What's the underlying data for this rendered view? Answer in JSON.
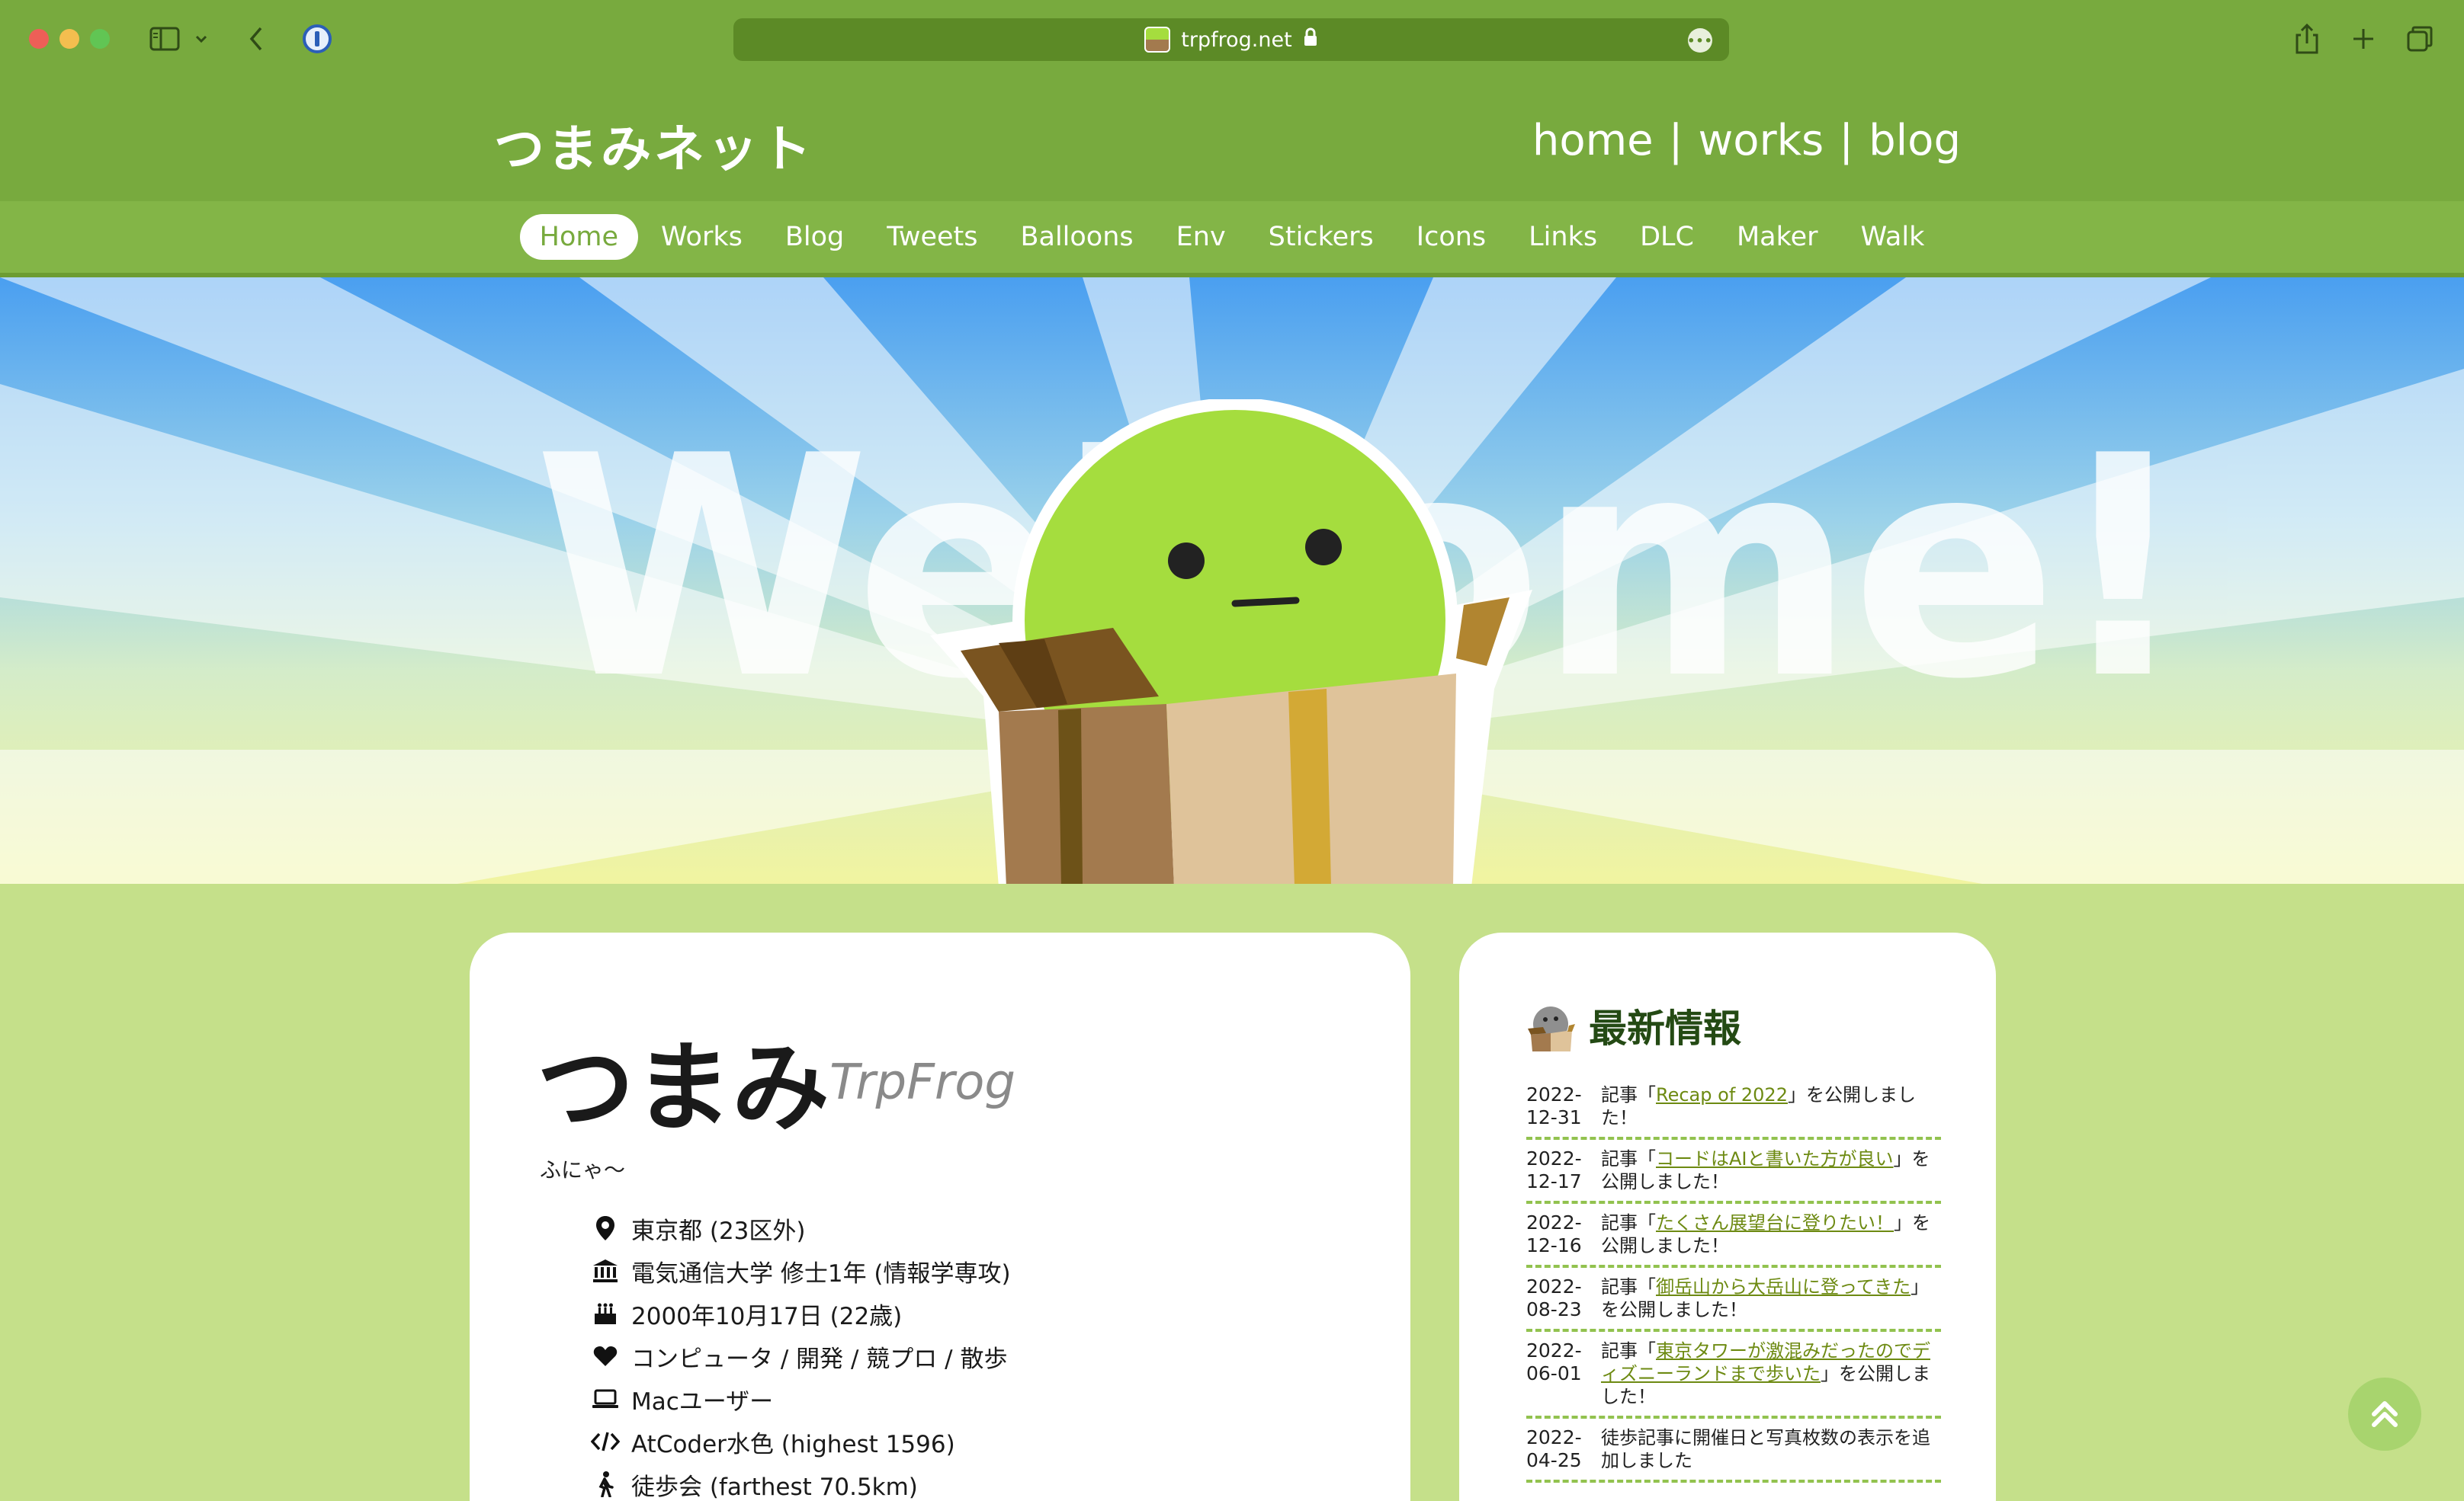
{
  "browser": {
    "url": "trpfrog.net"
  },
  "site": {
    "logo": "つまみネット",
    "top_links": [
      "home",
      "|",
      "works",
      "|",
      "blog"
    ],
    "nav": [
      "Home",
      "Works",
      "Blog",
      "Tweets",
      "Balloons",
      "Env",
      "Stickers",
      "Icons",
      "Links",
      "DLC",
      "Maker",
      "Walk"
    ],
    "active_nav": "Home"
  },
  "hero": {
    "welcome_text": "Welcome!"
  },
  "profile": {
    "name": "つまみ",
    "handle": "TrpFrog",
    "tagline": "ふにゃ〜",
    "info": [
      {
        "icon": "location-pin-icon",
        "text": "東京都 (23区外)"
      },
      {
        "icon": "university-icon",
        "text": "電気通信大学 修士1年 (情報学専攻)"
      },
      {
        "icon": "birthday-cake-icon",
        "text": "2000年10月17日 (22歳)"
      },
      {
        "icon": "heart-icon",
        "text": "コンピュータ / 開発 / 競プロ / 散歩"
      },
      {
        "icon": "laptop-icon",
        "text": "Macユーザー"
      },
      {
        "icon": "code-icon",
        "text": "AtCoder水色 (highest 1596)"
      },
      {
        "icon": "walking-icon",
        "text": "徒歩会 (farthest 70.5km)"
      }
    ]
  },
  "news": {
    "title": "最新情報",
    "items": [
      {
        "date": "2022-12-31",
        "prefix": "記事「",
        "link": "Recap of 2022",
        "suffix": "」を公開しました！"
      },
      {
        "date": "2022-12-17",
        "prefix": "記事「",
        "link": "コードはAIと書いた方が良い",
        "suffix": "」を公開しました！"
      },
      {
        "date": "2022-12-16",
        "prefix": "記事「",
        "link": "たくさん展望台に登りたい！",
        "suffix": "」を公開しました！"
      },
      {
        "date": "2022-08-23",
        "prefix": "記事「",
        "link": "御岳山から大岳山に登ってきた",
        "suffix": "」を公開しました！"
      },
      {
        "date": "2022-06-01",
        "prefix": "記事「",
        "link": "東京タワーが激混みだったのでディズニーランドまで歩いた",
        "suffix": "」を公開しました！"
      },
      {
        "date": "2022-04-25",
        "prefix": "",
        "link": "",
        "suffix": "徒歩記事に開催日と写真枚数の表示を追加しました"
      }
    ]
  },
  "colors": {
    "header_green": "#78aa3e",
    "nav_green": "#83b547",
    "page_bg": "#c5e08a",
    "mascot_green": "#a5dd3e",
    "link_color": "#6d8a12"
  }
}
